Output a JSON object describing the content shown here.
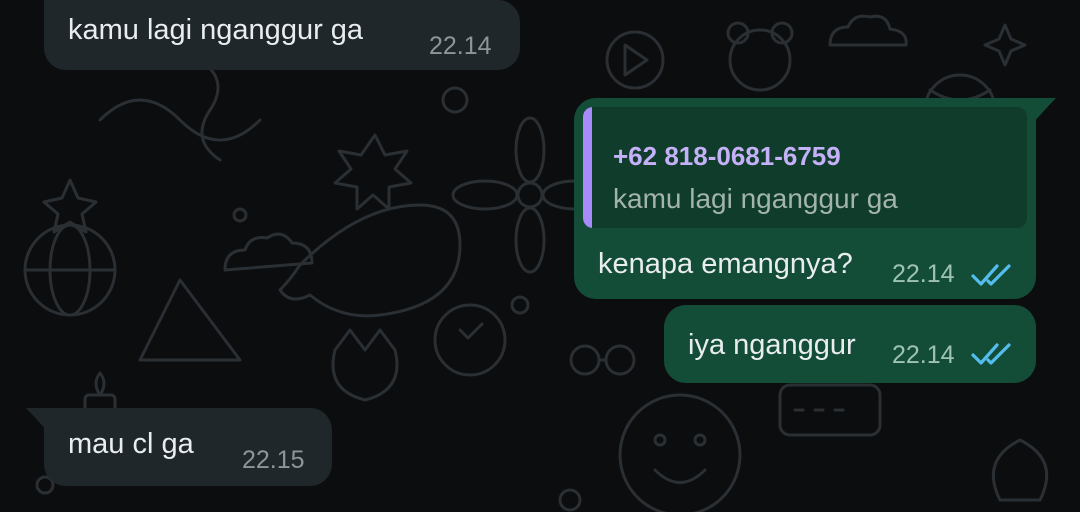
{
  "messages": [
    {
      "direction": "incoming",
      "text": "kamu lagi nganggur ga",
      "time": "22.14"
    },
    {
      "direction": "outgoing",
      "quoted": {
        "sender": "+62 818-0681-6759",
        "text": "kamu lagi nganggur ga"
      },
      "text": "kenapa emangnya?",
      "time": "22.14",
      "status": "read"
    },
    {
      "direction": "outgoing",
      "text": "iya nganggur",
      "time": "22.14",
      "status": "read"
    },
    {
      "direction": "incoming",
      "text": "mau cl ga",
      "time": "22.15"
    }
  ],
  "colors": {
    "background": "#0b0d0f",
    "incoming_bubble": "#1f272a",
    "outgoing_bubble": "#144d37",
    "read_ticks": "#53bdeb",
    "quote_accent": "#a78bfa"
  },
  "icons": {
    "read_receipt": "double-check-icon"
  }
}
